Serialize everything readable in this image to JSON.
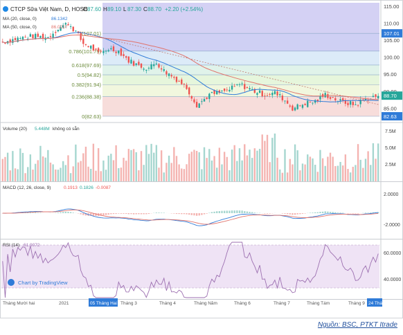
{
  "header": {
    "symbol": "CTCP Sữa Việt Nam, D, HOSE",
    "o_label": "O",
    "o": "87.60",
    "h_label": "H",
    "h": "89.10",
    "l_label": "L",
    "l": "87.30",
    "c_label": "C",
    "c": "88.70",
    "change": "+2.20 (+2.54%)"
  },
  "ma_legends": [
    {
      "label": "MA (20, close, 0)",
      "value": "86.1342",
      "color": "#2f7bd8"
    },
    {
      "label": "MA (50, close, 0)",
      "value": "86.0217",
      "color": "#e0736c"
    }
  ],
  "volume_legend": {
    "label": "Volume (20)",
    "value": "5.448M",
    "note": "không có sẵn"
  },
  "macd_legend": {
    "label": "MACD (12, 26, close, 9)",
    "v1": "0.1913",
    "v2": "0.1826",
    "v3": "-0.0087"
  },
  "rsi_legend": {
    "label": "RSI (14)",
    "value": "61.9072"
  },
  "watermark": "Chart by TradingView",
  "source": "Nguồn: BSC, PTKT Itrade",
  "colors": {
    "up": "#26a69a",
    "down": "#ef5350",
    "ma20": "#2f7bd8",
    "ma50": "#e0736c",
    "macd": "#2f7bd8",
    "signal": "#e0736c",
    "rsi": "#9c6fb0",
    "axis_tag_blue": "#2f7bd8",
    "axis_tag_teal": "#26a69a"
  },
  "chart_data": {
    "type": "candlestick",
    "price_axis": {
      "ticks": [
        "115.00",
        "110.00",
        "105.00",
        "100.00",
        "95.00",
        "90.00",
        "85.00"
      ],
      "ylim": [
        81,
        116
      ]
    },
    "axis_tags": {
      "top": "107.01",
      "last": "88.70",
      "low": "82.63"
    },
    "fib_levels": [
      {
        "ratio": "1(107.01)",
        "value": 107.01,
        "fill": "#c7c8f2"
      },
      {
        "ratio": "0.786(101.79)",
        "value": 101.79,
        "fill": "#d6e8f7"
      },
      {
        "ratio": "0.618(97.69)",
        "value": 97.69,
        "fill": "#daf1e6"
      },
      {
        "ratio": "0.5(94.82)",
        "value": 94.82,
        "fill": "#e2f4d6"
      },
      {
        "ratio": "0.382(91.94)",
        "value": 91.94,
        "fill": "#eef6d8"
      },
      {
        "ratio": "0.236(88.38)",
        "value": 88.38,
        "fill": "#f6d7d5"
      },
      {
        "ratio": "0(82.63)",
        "value": 82.63,
        "fill": "#ffffff"
      }
    ],
    "x_labels": [
      "Tháng Mười hai",
      "2021",
      "05 Tháng Hai '21",
      "Tháng 3",
      "Tháng 4",
      "Tháng Năm",
      "Tháng 6",
      "Tháng 7",
      "Tháng Tám",
      "Tháng 9",
      "24 Tháng"
    ],
    "close_path_points": [
      [
        0,
        104.5
      ],
      [
        6,
        105.5
      ],
      [
        12,
        106.2
      ],
      [
        18,
        105.8
      ],
      [
        22,
        108.5
      ],
      [
        26,
        110.0
      ],
      [
        29,
        107.5
      ],
      [
        32,
        104.0
      ],
      [
        35,
        103.0
      ],
      [
        38,
        101.0
      ],
      [
        42,
        102.5
      ],
      [
        46,
        101.8
      ],
      [
        50,
        99.0
      ],
      [
        54,
        97.5
      ],
      [
        58,
        96.8
      ],
      [
        61,
        98.5
      ],
      [
        64,
        96.0
      ],
      [
        67,
        94.5
      ],
      [
        70,
        93.0
      ],
      [
        73,
        91.0
      ],
      [
        75,
        88.5
      ],
      [
        77,
        86.0
      ],
      [
        79,
        87.0
      ],
      [
        82,
        89.0
      ],
      [
        86,
        89.5
      ],
      [
        90,
        90.5
      ],
      [
        94,
        92.0
      ],
      [
        97,
        91.0
      ],
      [
        100,
        90.0
      ],
      [
        104,
        89.0
      ],
      [
        108,
        89.5
      ],
      [
        111,
        88.0
      ],
      [
        113,
        86.5
      ],
      [
        115,
        85.0
      ],
      [
        117,
        85.5
      ],
      [
        120,
        86.5
      ],
      [
        124,
        87.0
      ],
      [
        128,
        89.0
      ],
      [
        131,
        88.0
      ],
      [
        134,
        87.0
      ],
      [
        137,
        86.5
      ],
      [
        140,
        86.0
      ],
      [
        143,
        87.5
      ],
      [
        146,
        88.0
      ],
      [
        149,
        88.7
      ]
    ],
    "volume_ticks": [
      "7.5M",
      "5.0M",
      "2.5M"
    ],
    "macd_ticks": [
      "2.0000",
      "-2.0000"
    ],
    "rsi_ticks": [
      "60.0000",
      "40.0000"
    ],
    "rsi_last": 61.9072
  }
}
